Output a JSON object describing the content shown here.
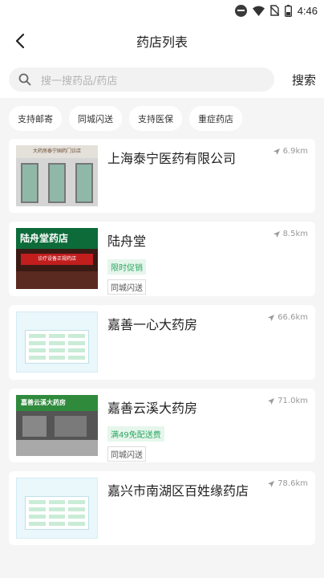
{
  "status_bar": {
    "time": "4:46"
  },
  "header": {
    "title": "药店列表"
  },
  "search": {
    "placeholder": "搜一搜药品/药店",
    "button_label": "搜索"
  },
  "filters": [
    "支持邮寄",
    "同城闪送",
    "支持医保",
    "重症药店"
  ],
  "stores": [
    {
      "name": "上海泰宁医药有限公司",
      "distance": "6.9km",
      "promo": "",
      "tag": "",
      "image_text": "大药房泰宁国药门诊店"
    },
    {
      "name": "陆舟堂",
      "distance": "8.5km",
      "promo": "限时促销",
      "tag": "同城闪送",
      "image_text": "陆舟堂药店",
      "image_banner": "诊疗设备正规药店"
    },
    {
      "name": "嘉善一心大药房",
      "distance": "66.6km",
      "promo": "",
      "tag": ""
    },
    {
      "name": "嘉善云溪大药房",
      "distance": "71.0km",
      "promo": "满49免配送费",
      "tag": "同城闪送",
      "image_text": "嘉善云溪大药房"
    },
    {
      "name": "嘉兴市南湖区百姓缘药店",
      "distance": "78.6km",
      "promo": "",
      "tag": ""
    }
  ]
}
